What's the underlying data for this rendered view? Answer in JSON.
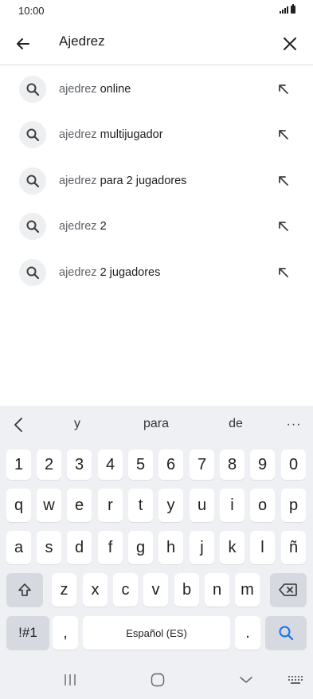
{
  "status_bar": {
    "time": "10:00"
  },
  "search": {
    "query": "Ajedrez"
  },
  "suggestions": [
    {
      "prefix": "ajedrez",
      "suffix": " online"
    },
    {
      "prefix": "ajedrez",
      "suffix": " multijugador"
    },
    {
      "prefix": "ajedrez",
      "suffix": " para 2 jugadores"
    },
    {
      "prefix": "ajedrez",
      "suffix": " 2"
    },
    {
      "prefix": "ajedrez",
      "suffix": " 2 jugadores"
    }
  ],
  "keyboard": {
    "predictions": [
      "y",
      "para",
      "de"
    ],
    "more": "···",
    "row_numbers": [
      "1",
      "2",
      "3",
      "4",
      "5",
      "6",
      "7",
      "8",
      "9",
      "0"
    ],
    "row1": [
      "q",
      "w",
      "e",
      "r",
      "t",
      "y",
      "u",
      "i",
      "o",
      "p"
    ],
    "row2": [
      "a",
      "s",
      "d",
      "f",
      "g",
      "h",
      "j",
      "k",
      "l",
      "ñ"
    ],
    "row3": [
      "z",
      "x",
      "c",
      "v",
      "b",
      "n",
      "m"
    ],
    "symbols_label": "!#1",
    "comma": ",",
    "space_label": "Español (ES)",
    "period": "."
  },
  "colors": {
    "accent": "#1a73e8",
    "keyboard_bg": "#eef0f3",
    "key_dark": "#d6d9df"
  }
}
